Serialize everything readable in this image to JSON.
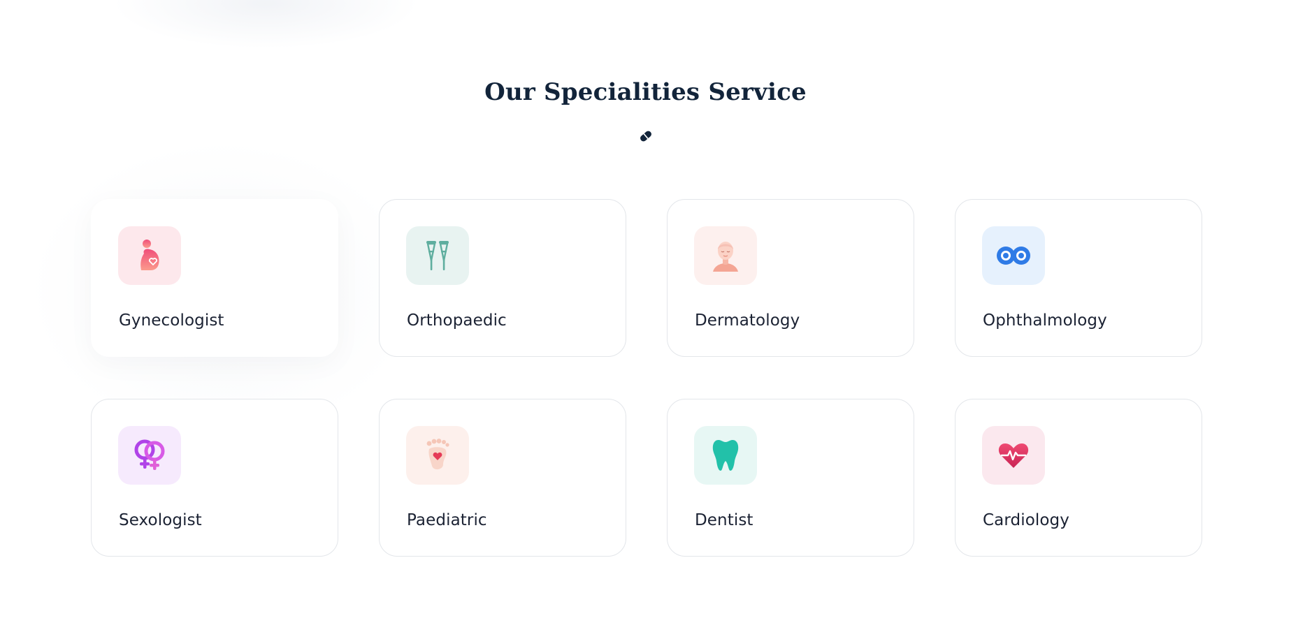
{
  "section": {
    "title": "Our Specialities Service",
    "divider_icon": "pill-icon"
  },
  "specialities": [
    {
      "label": "Gynecologist",
      "icon": "pregnant-woman-icon",
      "tint": "#fde8ec",
      "accent": "#f26a86"
    },
    {
      "label": "Orthopaedic",
      "icon": "crutches-icon",
      "tint": "#e8f3f1",
      "accent": "#5fae9f"
    },
    {
      "label": "Dermatology",
      "icon": "face-skin-icon",
      "tint": "#fdf0ee",
      "accent": "#f4a594"
    },
    {
      "label": "Ophthalmology",
      "icon": "eyes-icon",
      "tint": "#e6f1fd",
      "accent": "#2f7be6"
    },
    {
      "label": "Sexologist",
      "icon": "gender-symbols-icon",
      "tint": "#f6eafd",
      "accent": "#c046e8"
    },
    {
      "label": "Paediatric",
      "icon": "baby-foot-heart-icon",
      "tint": "#fdf0ec",
      "accent": "#f0b8a6"
    },
    {
      "label": "Dentist",
      "icon": "tooth-icon",
      "tint": "#e7f7f4",
      "accent": "#22c1a9"
    },
    {
      "label": "Cardiology",
      "icon": "heart-pulse-icon",
      "tint": "#fbe8ee",
      "accent": "#e23d66"
    }
  ],
  "active_index": 0,
  "colors": {
    "heading": "#12243a",
    "text": "#1b2233",
    "card_border": "#e3e6ea"
  }
}
